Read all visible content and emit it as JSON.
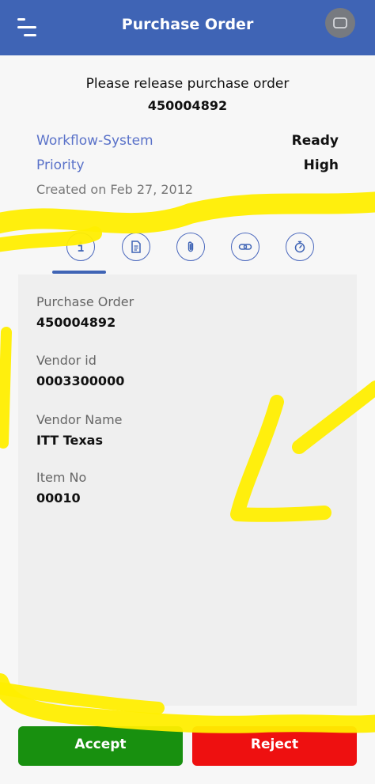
{
  "header": {
    "title": "Purchase Order",
    "menu_icon": "hamburger-menu-icon",
    "action_icon": "screen-icon"
  },
  "intro": {
    "message": "Please release purchase order",
    "po_number": "450004892"
  },
  "meta": [
    {
      "key": "Workflow-System",
      "value": "Ready"
    },
    {
      "key": "Priority",
      "value": "High"
    }
  ],
  "created": "Created on Feb 27, 2012",
  "tabs": [
    {
      "icon": "info-icon",
      "selected": true
    },
    {
      "icon": "document-icon",
      "selected": false
    },
    {
      "icon": "paperclip-icon",
      "selected": false
    },
    {
      "icon": "link-icon",
      "selected": false
    },
    {
      "icon": "stopwatch-icon",
      "selected": false
    }
  ],
  "details": [
    {
      "label": "Purchase Order",
      "value": "450004892"
    },
    {
      "label": "Vendor id",
      "value": "0003300000"
    },
    {
      "label": "Vendor Name",
      "value": "ITT Texas"
    },
    {
      "label": "Item No",
      "value": "00010"
    }
  ],
  "actions": {
    "accept": "Accept",
    "reject": "Reject"
  },
  "colors": {
    "header": "#3f64b5",
    "link_text": "#5a72c9",
    "accept": "#18900f",
    "reject": "#ee1010",
    "highlight": "#ffee00"
  }
}
